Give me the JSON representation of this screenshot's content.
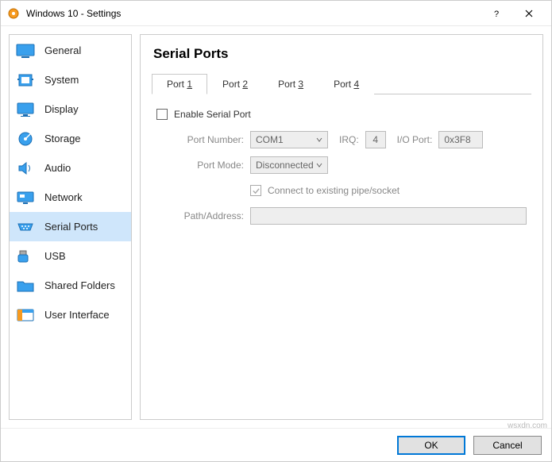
{
  "titlebar": {
    "title": "Windows 10 - Settings"
  },
  "sidebar": {
    "items": [
      {
        "label": "General"
      },
      {
        "label": "System"
      },
      {
        "label": "Display"
      },
      {
        "label": "Storage"
      },
      {
        "label": "Audio"
      },
      {
        "label": "Network"
      },
      {
        "label": "Serial Ports"
      },
      {
        "label": "USB"
      },
      {
        "label": "Shared Folders"
      },
      {
        "label": "User Interface"
      }
    ],
    "selected": "Serial Ports"
  },
  "page": {
    "title": "Serial Ports"
  },
  "tabs": [
    {
      "label_pre": "Port ",
      "label_num": "1",
      "active": true
    },
    {
      "label_pre": "Port ",
      "label_num": "2",
      "active": false
    },
    {
      "label_pre": "Port ",
      "label_num": "3",
      "active": false
    },
    {
      "label_pre": "Port ",
      "label_num": "4",
      "active": false
    }
  ],
  "form": {
    "enable_label": "Enable Serial Port",
    "port_number_label": "Port Number:",
    "port_number_value": "COM1",
    "irq_label": "IRQ:",
    "irq_value": "4",
    "io_port_label": "I/O Port:",
    "io_port_value": "0x3F8",
    "port_mode_label": "Port Mode:",
    "port_mode_value": "Disconnected",
    "connect_label": "Connect to existing pipe/socket",
    "path_label": "Path/Address:",
    "path_value": ""
  },
  "footer": {
    "ok": "OK",
    "cancel": "Cancel"
  },
  "watermark": "wsxdn.com"
}
